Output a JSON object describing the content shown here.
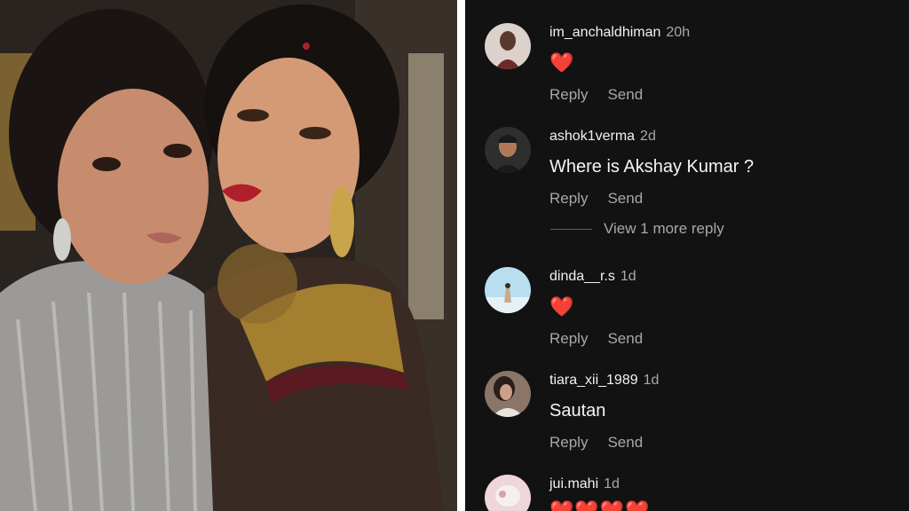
{
  "photo": {
    "alt": ""
  },
  "comments": [
    {
      "username": "im_anchaldhiman",
      "time": "20h",
      "text": "❤️",
      "is_emoji": true,
      "reply": "Reply",
      "send": "Send",
      "avatar_color": "#d9c8c3"
    },
    {
      "username": "ashok1verma",
      "time": "2d",
      "text": "Where is Akshay Kumar ?",
      "is_emoji": false,
      "reply": "Reply",
      "send": "Send",
      "avatar_color": "#3b3b3b"
    },
    {
      "username": "dinda__r.s",
      "time": "1d",
      "text": "❤️",
      "is_emoji": true,
      "reply": "Reply",
      "send": "Send",
      "avatar_color": "#a8d7ea"
    },
    {
      "username": "tiara_xii_1989",
      "time": "1d",
      "text": "Sautan",
      "is_emoji": false,
      "reply": "Reply",
      "send": "Send",
      "avatar_color": "#6e5a4e"
    },
    {
      "username": "jui.mahi",
      "time": "1d",
      "text": "❤️❤️❤️❤️",
      "is_emoji": true,
      "reply": "",
      "send": "",
      "avatar_color": "#e8c9cd"
    }
  ],
  "view_more": "View 1 more reply",
  "colors": {
    "panel_bg": "#121212",
    "muted": "#a8a8a8",
    "heart": "#e0261b"
  }
}
